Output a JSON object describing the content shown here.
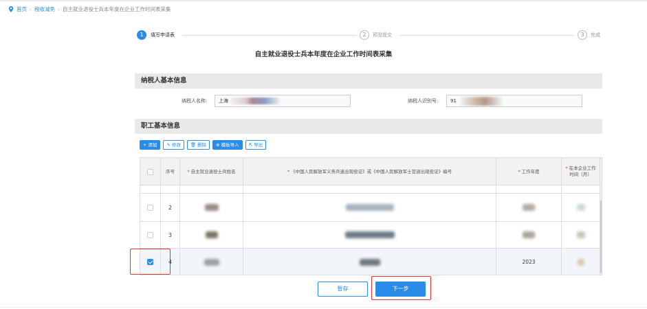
{
  "breadcrumb": {
    "items": [
      "首页",
      "税收减免",
      "自主就业退役士兵本年度在企业工作时间表采集"
    ],
    "separator": "›"
  },
  "steps": [
    {
      "num": "1",
      "label": "填写申请表"
    },
    {
      "num": "2",
      "label": "预览提交"
    },
    {
      "num": "3",
      "label": "完成"
    }
  ],
  "page_title": "自主就业退役士兵本年度在企业工作时间表采集",
  "taxpayer_section": {
    "title": "纳税人基本信息",
    "name_label": "纳税人名称:",
    "name_value": "上海",
    "id_label": "纳税人识别号:",
    "id_value": "91"
  },
  "employee_section": {
    "title": "职工基本信息"
  },
  "toolbar": {
    "add": "添加",
    "edit": "修改",
    "delete": "删除",
    "template_import": "模板导入",
    "export": "导出"
  },
  "table": {
    "headers": {
      "index": "序号",
      "name": "自主就业退役士兵姓名",
      "cert": "《中国人民解放军义务兵退出现役证》或《中国人民解放军士官退出现役证》编号",
      "year": "工作年度",
      "months": "在本企业工作时间（月）"
    },
    "rows": [
      {
        "index": "2",
        "year": "",
        "checked": false
      },
      {
        "index": "3",
        "year": "",
        "checked": false
      },
      {
        "index": "4",
        "year": "2023",
        "checked": true
      }
    ]
  },
  "buttons": {
    "save": "暂存",
    "next": "下一步"
  },
  "colors": {
    "accent": "#2a8ce8",
    "highlight": "#e0352b"
  }
}
